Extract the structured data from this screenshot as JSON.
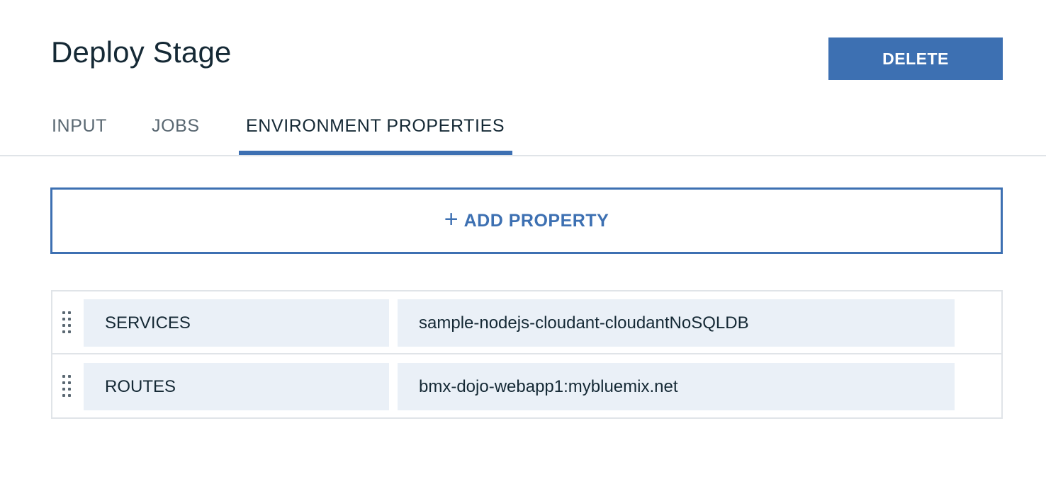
{
  "header": {
    "title": "Deploy Stage",
    "delete_label": "DELETE"
  },
  "tabs": [
    {
      "label": "INPUT",
      "active": false
    },
    {
      "label": "JOBS",
      "active": false
    },
    {
      "label": "ENVIRONMENT PROPERTIES",
      "active": true
    }
  ],
  "add_property": {
    "icon": "plus-icon",
    "label": "ADD PROPERTY"
  },
  "properties": [
    {
      "name": "SERVICES",
      "value": "sample-nodejs-cloudant-cloudantNoSQLDB"
    },
    {
      "name": "ROUTES",
      "value": "bmx-dojo-webapp1:mybluemix.net"
    }
  ],
  "colors": {
    "accent": "#3d70b2",
    "text": "#152935",
    "muted": "#5a6872",
    "field_bg": "#eaf0f7",
    "border": "#e0e4e8"
  }
}
